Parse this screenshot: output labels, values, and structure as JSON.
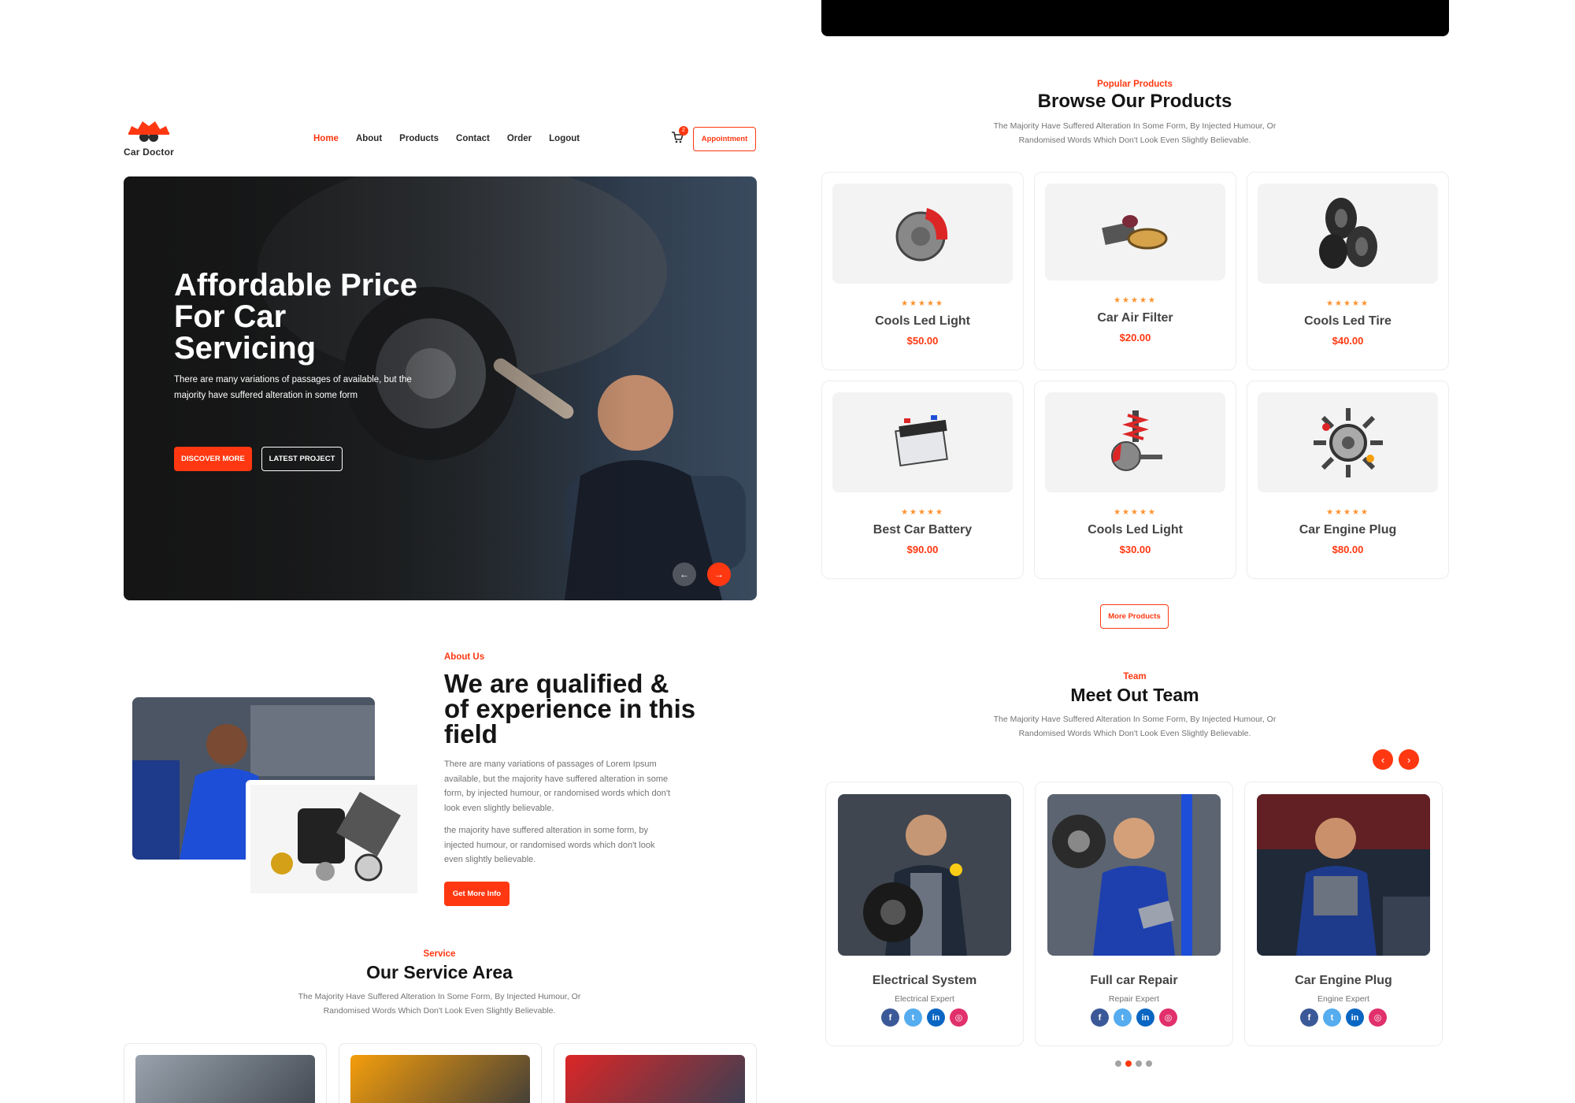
{
  "brand": {
    "name": "Car Doctor",
    "accent": "#ff3811"
  },
  "nav": {
    "items": [
      {
        "label": "Home"
      },
      {
        "label": "About"
      },
      {
        "label": "Products"
      },
      {
        "label": "Contact"
      },
      {
        "label": "Order"
      },
      {
        "label": "Logout"
      }
    ],
    "cart_count": "2",
    "appointment_label": "Appointment"
  },
  "hero": {
    "title": "Affordable Price For Car Servicing",
    "text": "There are many variations of passages of available, but the majority have suffered alteration in some form",
    "primary_btn": "DISCOVER MORE",
    "secondary_btn": "LATEST PROJECT",
    "prev_icon": "←",
    "next_icon": "→"
  },
  "about": {
    "kicker": "About Us",
    "title": "We are qualified & of experience in this field",
    "p1": "There are many variations of passages of Lorem Ipsum available, but the majority have suffered alteration in some form, by injected humour, or randomised words which don't look even slightly believable.",
    "p2": "the majority have suffered alteration in some form, by injected humour, or randomised words which don't look even slightly believable.",
    "button": "Get More Info"
  },
  "service": {
    "kicker": "Service",
    "title": "Our Service Area",
    "text": "The Majority Have Suffered Alteration In Some Form, By Injected Humour, Or Randomised Words Which Don't Look Even Slightly Believable."
  },
  "products": {
    "kicker": "Popular Products",
    "title": "Browse Our Products",
    "text": "The Majority Have Suffered Alteration In Some Form, By Injected Humour, Or Randomised Words Which Don't Look Even Slightly Believable.",
    "items": [
      {
        "name": "Cools Led Light",
        "price": "$50.00",
        "stars": "★★★★★",
        "icon": "brake-disc-icon"
      },
      {
        "name": "Car Air Filter",
        "price": "$20.00",
        "stars": "★★★★★",
        "icon": "air-filter-icon"
      },
      {
        "name": "Cools Led Tire",
        "price": "$40.00",
        "stars": "★★★★★",
        "icon": "tire-stack-icon"
      },
      {
        "name": "Best Car Battery",
        "price": "$90.00",
        "stars": "★★★★★",
        "icon": "battery-icon"
      },
      {
        "name": "Cools Led Light",
        "price": "$30.00",
        "stars": "★★★★★",
        "icon": "shock-absorber-icon"
      },
      {
        "name": "Car Engine Plug",
        "price": "$80.00",
        "stars": "★★★★★",
        "icon": "engine-parts-icon"
      }
    ],
    "more_label": "More Products"
  },
  "team": {
    "kicker": "Team",
    "title": "Meet Out Team",
    "text": "The Majority Have Suffered Alteration In Some Form, By Injected Humour, Or Randomised Words Which Don't Look Even Slightly Believable.",
    "prev_icon": "‹",
    "next_icon": "›",
    "members": [
      {
        "name": "Electrical System",
        "role": "Electrical Expert"
      },
      {
        "name": "Full car Repair",
        "role": "Repair Expert"
      },
      {
        "name": "Car Engine Plug",
        "role": "Engine Expert"
      }
    ],
    "social": [
      {
        "label": "f",
        "color": "#3b5998",
        "icon": "facebook-icon"
      },
      {
        "label": "t",
        "color": "#55acee",
        "icon": "twitter-icon"
      },
      {
        "label": "in",
        "color": "#0a66c2",
        "icon": "linkedin-icon"
      },
      {
        "label": "◎",
        "color": "#e1306c",
        "icon": "instagram-icon"
      }
    ]
  }
}
